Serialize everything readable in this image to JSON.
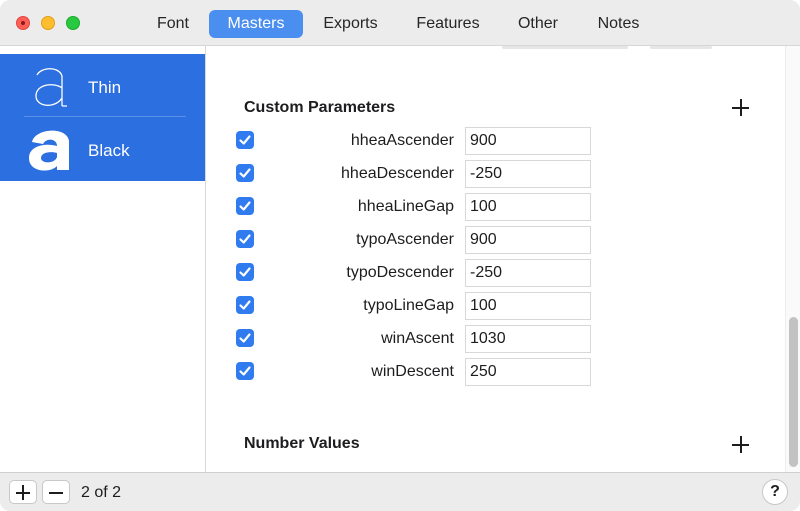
{
  "tabs": [
    {
      "label": "Font",
      "active": false
    },
    {
      "label": "Masters",
      "active": true
    },
    {
      "label": "Exports",
      "active": false
    },
    {
      "label": "Features",
      "active": false
    },
    {
      "label": "Other",
      "active": false
    },
    {
      "label": "Notes",
      "active": false
    }
  ],
  "sidebar": {
    "masters": [
      {
        "label": "Thin",
        "glyph": "a",
        "selected": true
      },
      {
        "label": "Black",
        "glyph": "a",
        "selected": true
      }
    ]
  },
  "sections": {
    "custom_parameters_title": "Custom Parameters",
    "number_values_title": "Number Values"
  },
  "custom_parameters": [
    {
      "name": "hheaAscender",
      "value": "900",
      "checked": true
    },
    {
      "name": "hheaDescender",
      "value": "-250",
      "checked": true
    },
    {
      "name": "hheaLineGap",
      "value": "100",
      "checked": true
    },
    {
      "name": "typoAscender",
      "value": "900",
      "checked": true
    },
    {
      "name": "typoDescender",
      "value": "-250",
      "checked": true
    },
    {
      "name": "typoLineGap",
      "value": "100",
      "checked": true
    },
    {
      "name": "winAscent",
      "value": "1030",
      "checked": true
    },
    {
      "name": "winDescent",
      "value": "250",
      "checked": true
    }
  ],
  "footer": {
    "count_text": "2 of 2",
    "help_label": "?"
  },
  "colors": {
    "accent": "#2c6fe0",
    "tab_active": "#4a8ef0",
    "checkbox": "#2f7bef"
  }
}
